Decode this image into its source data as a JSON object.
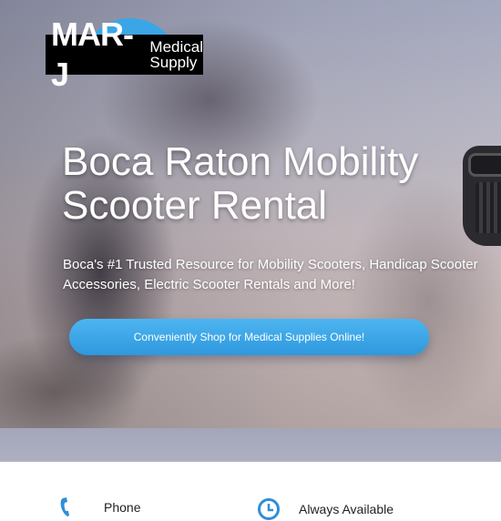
{
  "logo": {
    "main": "MAR-J",
    "sub_line1": "Medical",
    "sub_line2": "Supply"
  },
  "hero": {
    "title": "Boca Raton Mobility Scooter Rental",
    "subtitle": "Boca's #1 Trusted Resource for Mobility Scooters, Handicap Scooter Accessories, Electric Scooter Rentals and More!",
    "cta_label": "Conveniently Shop for Medical Supplies Online!"
  },
  "features": [
    {
      "label": "Phone",
      "icon": "phone-icon"
    },
    {
      "label": "Always Available",
      "icon": "clock-icon"
    }
  ],
  "colors": {
    "accent": "#3aa6e6",
    "cta": "#3da6e8",
    "title_text": "#ffffff"
  }
}
